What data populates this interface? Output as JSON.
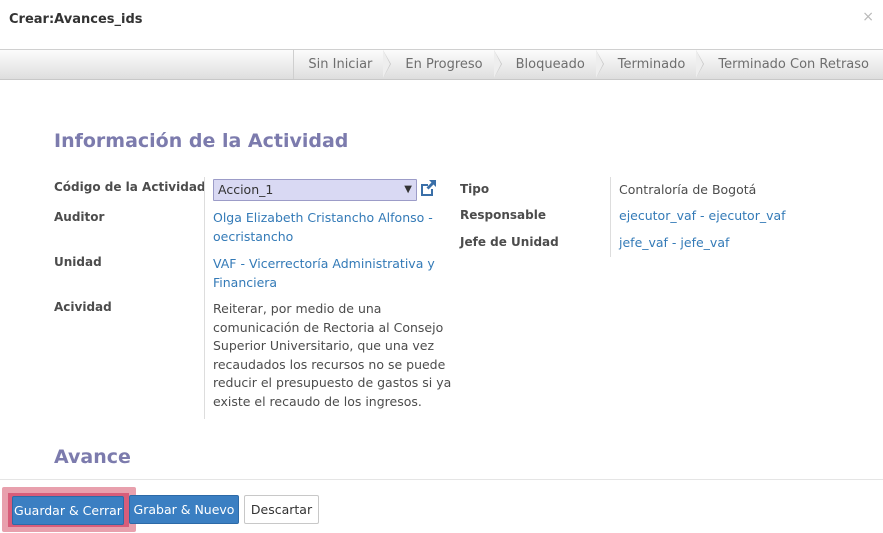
{
  "window": {
    "title": "Crear:Avances_ids",
    "close_glyph": "×"
  },
  "statusbar": {
    "stages": [
      "Sin Iniciar",
      "En Progreso",
      "Bloqueado",
      "Terminado",
      "Terminado Con Retraso"
    ]
  },
  "sections": {
    "info_title": "Información de la Actividad",
    "avance_title": "Avance"
  },
  "left_fields": {
    "codigo_label": "Código de la Actividad",
    "codigo_value": "Accion_1",
    "auditor_label": "Auditor",
    "auditor_line1": "Olga Elizabeth Cristancho Alfonso -",
    "auditor_line2": "oecristancho",
    "unidad_label": "Unidad",
    "unidad_line1": "VAF - Vicerrectoría Administrativa y",
    "unidad_line2": "Financiera",
    "actividad_label": "Acividad",
    "actividad_lines": [
      "Reiterar, por medio de una",
      "comunicación de Rectoria al Consejo",
      "Superior Universitario, que una vez",
      "recaudados los recursos no se puede",
      "reducir el presupuesto de gastos si ya",
      "existe el recaudo de los ingresos."
    ]
  },
  "right_fields": {
    "tipo_label": "Tipo",
    "tipo_value": "Contraloría de Bogotá",
    "responsable_label": "Responsable",
    "responsable_value": "ejecutor_vaf - ejecutor_vaf",
    "jefe_label": "Jefe de Unidad",
    "jefe_value": "jefe_vaf - jefe_vaf"
  },
  "footer": {
    "save_close": "Guardar & Cerrar",
    "save_new": "Grabar & Nuevo",
    "discard": "Descartar"
  },
  "icons": {
    "external_link": "external-link-icon",
    "dropdown": "caret-down-icon"
  },
  "colors": {
    "section_title": "#7c7bad",
    "link": "#337ab7",
    "primary_button": "#3b7fc2",
    "select_bg": "#d9d9f3"
  }
}
